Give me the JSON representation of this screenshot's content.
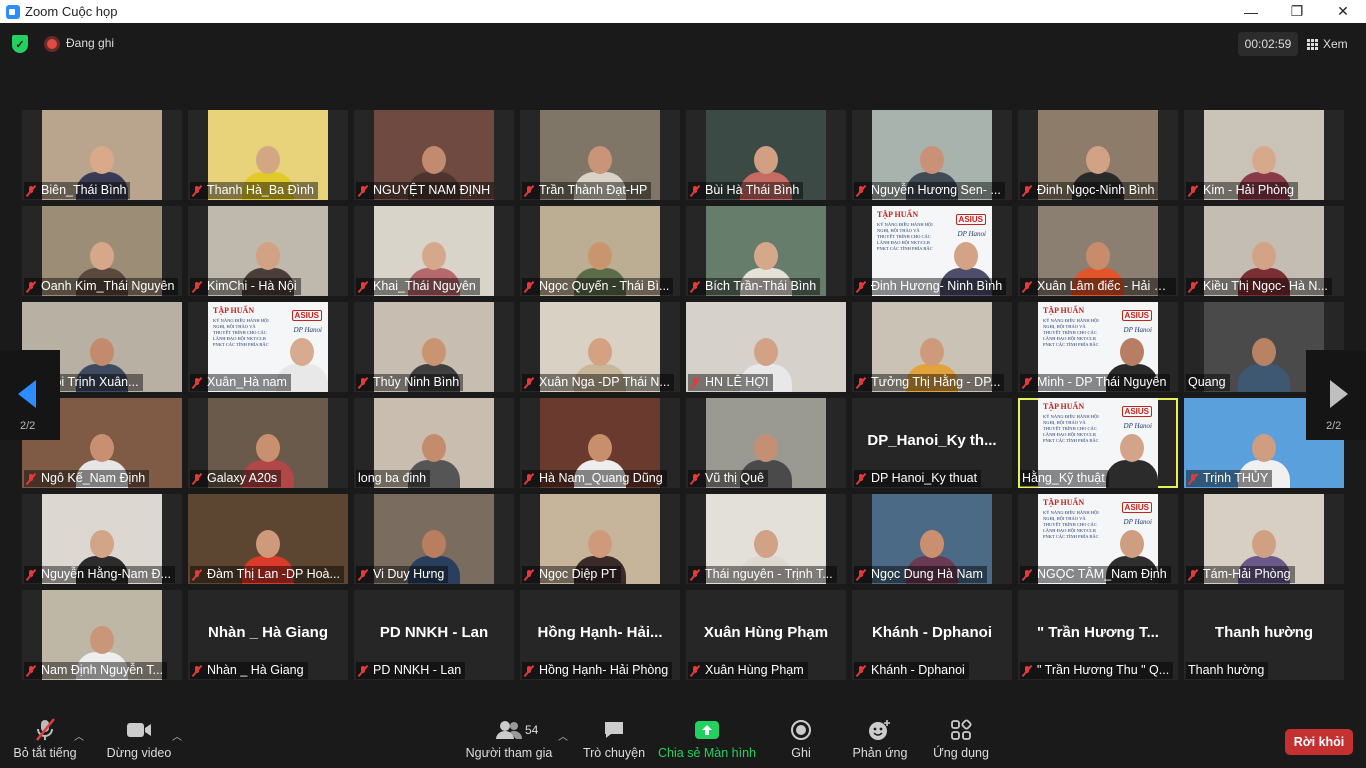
{
  "window": {
    "title": "Zoom Cuộc họp",
    "minimize": "—",
    "restore": "❐",
    "close": "✕"
  },
  "topbar": {
    "recording_label": "Đang ghi",
    "timer": "00:02:59",
    "view_label": "Xem"
  },
  "pagination": {
    "left": "2/2",
    "right": "2/2"
  },
  "participants": [
    {
      "name": "Biên_Thái Bình",
      "muted": true,
      "kind": "video",
      "bg": "#b9a48e",
      "skin": "#d9a98a",
      "shirt": "#3a3a55"
    },
    {
      "name": "Thanh Hà_Ba Đình",
      "muted": true,
      "kind": "video",
      "bg": "#e8d27a",
      "skin": "#d4a784",
      "shirt": "#e2c92a"
    },
    {
      "name": "NGUYỆT NAM  ĐỊNH",
      "muted": true,
      "kind": "video",
      "bg": "#6e4a40",
      "skin": "#c28b70",
      "shirt": "#4c3530"
    },
    {
      "name": "Trần Thành Đạt-HP",
      "muted": true,
      "kind": "video",
      "bg": "#7f7667",
      "skin": "#c99478",
      "shirt": "#d8d2c7"
    },
    {
      "name": "Bùi Hà Thái Bình",
      "muted": true,
      "kind": "video",
      "bg": "#3b4a44",
      "skin": "#d29f82",
      "shirt": "#c66b63"
    },
    {
      "name": "Nguyễn Hương Sen- ...",
      "muted": true,
      "kind": "video",
      "bg": "#a8b3ae",
      "skin": "#c99178",
      "shirt": "#3f4a55"
    },
    {
      "name": "Đinh Ngọc-Ninh Bình",
      "muted": true,
      "kind": "video",
      "bg": "#8d7c6a",
      "skin": "#d2a286",
      "shirt": "#2a2a2a"
    },
    {
      "name": "Kim - Hải Phòng",
      "muted": true,
      "kind": "video",
      "bg": "#c9c3b8",
      "skin": "#d6a98c",
      "shirt": "#8a3b4a"
    },
    {
      "name": "Oanh Kim_Thái Nguyên",
      "muted": true,
      "kind": "video",
      "bg": "#9c8e76",
      "skin": "#d6a789",
      "shirt": "#5a4a3e"
    },
    {
      "name": "KimChi - Hà Nội",
      "muted": true,
      "kind": "video",
      "bg": "#bfb9ad",
      "skin": "#d3a285",
      "shirt": "#4b3e3a"
    },
    {
      "name": "Khai_Thái Nguyên",
      "muted": true,
      "kind": "video",
      "bg": "#d8d4ca",
      "skin": "#d6a88b",
      "shirt": "#b5696d"
    },
    {
      "name": "Ngọc Quyến - Thái Bì...",
      "muted": true,
      "kind": "video",
      "bg": "#bcae92",
      "skin": "#c9956f",
      "shirt": "#5d6d4a"
    },
    {
      "name": "Bích Trần-Thái Bình",
      "muted": true,
      "kind": "video",
      "bg": "#667d6c",
      "skin": "#d6a88b",
      "shirt": "#e6e1d8"
    },
    {
      "name": "Đinh Hương- Ninh Bình",
      "muted": true,
      "kind": "slide",
      "bg": "#f4f6f7",
      "skin": "#d4a286",
      "shirt": "#4e4e6a"
    },
    {
      "name": "Xuân Lâm điếc - Hải Phò...",
      "muted": true,
      "kind": "video",
      "bg": "#8b7f72",
      "skin": "#c88c6d",
      "shirt": "#e2552a"
    },
    {
      "name": "Kiều Thị Ngọc- Hà N...",
      "muted": true,
      "kind": "video",
      "bg": "#c3bdb4",
      "skin": "#d2a386",
      "shirt": "#7b2f33"
    },
    {
      "name": "Hà Nội Trịnh Xuân...",
      "muted": false,
      "kind": "wide",
      "bg": "#b8b0a3",
      "skin": "#c38a6c",
      "shirt": "#3e4a60"
    },
    {
      "name": "Xuân_Hà nam",
      "muted": true,
      "kind": "slide",
      "bg": "#f4f6f7",
      "skin": "#d6ab8f",
      "shirt": "#e8e8e8"
    },
    {
      "name": "Thủy Ninh Bình",
      "muted": true,
      "kind": "video",
      "bg": "#c7beb1",
      "skin": "#c9946f",
      "shirt": "#3f3f3f"
    },
    {
      "name": "Xuân Nga -DP Thái N...",
      "muted": true,
      "kind": "video",
      "bg": "#d9d2c4",
      "skin": "#d4a283",
      "shirt": "#c9b79a"
    },
    {
      "name": "HN LÊ HỢI",
      "muted": true,
      "kind": "wide",
      "bg": "#d6d2cb",
      "skin": "#d2a285",
      "shirt": "#e8e8e8"
    },
    {
      "name": "Tưởng Thị Hằng - DP...",
      "muted": true,
      "kind": "video",
      "bg": "#c9c2b5",
      "skin": "#cf9a7c",
      "shirt": "#e2a33c"
    },
    {
      "name": "Minh - DP Thái Nguyên",
      "muted": true,
      "kind": "slide",
      "bg": "#f4f6f7",
      "skin": "#b77e64",
      "shirt": "#2a2a2a"
    },
    {
      "name": "Quang",
      "muted": false,
      "kind": "video",
      "bg": "#4a4a4a",
      "skin": "#b88363",
      "shirt": "#3e5872"
    },
    {
      "name": "Ngô Kế_Nam Định",
      "muted": true,
      "kind": "wide",
      "bg": "#7f5a45",
      "skin": "#c88f70",
      "shirt": "#e6e6e6"
    },
    {
      "name": "Galaxy A20s",
      "muted": true,
      "kind": "video",
      "bg": "#6a5a4c",
      "skin": "#c9906f",
      "shirt": "#b14747"
    },
    {
      "name": "long ba đinh",
      "muted": false,
      "kind": "video",
      "bg": "#c8bdae",
      "skin": "#c48c6c",
      "shirt": "#555555"
    },
    {
      "name": "Hà Nam_Quang Dũng",
      "muted": true,
      "kind": "video",
      "bg": "#6b3a2e",
      "skin": "#c88f6d",
      "shirt": "#eeeeee"
    },
    {
      "name": "Vũ thị Quê",
      "muted": true,
      "kind": "video",
      "bg": "#9b9a92",
      "skin": "#c39073",
      "shirt": "#4a4a4a"
    },
    {
      "name": "DP Hanoi_Ky thuat",
      "muted": true,
      "kind": "text",
      "big": "DP_Hanoi_Ky th..."
    },
    {
      "name": "Hằng_Kỹ thuật",
      "muted": false,
      "kind": "slide",
      "active": true,
      "bg": "#f4f6f7",
      "skin": "#d4a488",
      "shirt": "#2b2b2b"
    },
    {
      "name": "Trịnh THỦY",
      "muted": true,
      "kind": "wide",
      "bg": "#5aa0dc",
      "skin": "#cf9d80",
      "shirt": "#f0f0f0"
    },
    {
      "name": "Nguyễn Hằng-Nam Đ...",
      "muted": true,
      "kind": "video",
      "bg": "#dcd8d1",
      "skin": "#d3a588",
      "shirt": "#2c2c2c"
    },
    {
      "name": "Đàm Thị Lan -DP Hoà...",
      "muted": true,
      "kind": "wide",
      "bg": "#5c4632",
      "skin": "#cf9a7a",
      "shirt": "#d93a2a"
    },
    {
      "name": "Vi Duy Hưng",
      "muted": true,
      "kind": "video",
      "bg": "#7a6d60",
      "skin": "#b97e5f",
      "shirt": "#2a3e5e"
    },
    {
      "name": "Ngọc Diệp PT",
      "muted": true,
      "kind": "video",
      "bg": "#c6b59a",
      "skin": "#cf9a7b",
      "shirt": "#3a2a2a"
    },
    {
      "name": "Thái nguyên - Trịnh T...",
      "muted": true,
      "kind": "video",
      "bg": "#e3e0da",
      "skin": "#d2a286",
      "shirt": "#ddd8d0"
    },
    {
      "name": "Ngọc Dung Hà Nam",
      "muted": true,
      "kind": "video",
      "bg": "#4a6a86",
      "skin": "#c98f6f",
      "shirt": "#6a3a52"
    },
    {
      "name": "NGỌC TÂM_Nam Định",
      "muted": true,
      "kind": "slide",
      "bg": "#f4f6f7",
      "skin": "#cf9d80",
      "shirt": "#2f2f2f"
    },
    {
      "name": "Tám-Hải Phòng",
      "muted": true,
      "kind": "video",
      "bg": "#d8cfc4",
      "skin": "#d0a083",
      "shirt": "#6a5a8a"
    },
    {
      "name": "Nam Định  Nguyễn T...",
      "muted": true,
      "kind": "video",
      "bg": "#bfb7a6",
      "skin": "#c9967a",
      "shirt": "#eeeeee"
    },
    {
      "name": "Nhàn _ Hà Giang",
      "muted": true,
      "kind": "text",
      "big": "Nhàn _ Hà Giang"
    },
    {
      "name": "PD NNKH - Lan",
      "muted": true,
      "kind": "text",
      "big": "PD NNKH - Lan"
    },
    {
      "name": "Hồng Hạnh- Hải Phòng",
      "muted": true,
      "kind": "text",
      "big": "Hồng  Hạnh-  Hải..."
    },
    {
      "name": "Xuân Hùng Phạm",
      "muted": true,
      "kind": "text",
      "big": "Xuân Hùng Phạm"
    },
    {
      "name": "Khánh - Dphanoi",
      "muted": true,
      "kind": "text",
      "big": "Khánh - Dphanoi"
    },
    {
      "name": "\" Trần Hương Thu \" Q...",
      "muted": true,
      "kind": "text",
      "big": "\" Trần Hương T..."
    },
    {
      "name": "Thanh hường",
      "muted": false,
      "kind": "text",
      "big": "Thanh hường"
    }
  ],
  "slide": {
    "title": "TẬP HUẤN",
    "body": "KỸ NĂNG ĐIỀU HÀNH HỘI NGHỊ, HỘI THẢO VÀ THUYẾT TRÌNH CHO CÁC LÃNH ĐẠO HỘI NKT/CLB PNKT CÁC TỈNH PHÍA BẮC",
    "logo": "ASIUS",
    "org": "DP Hanoi"
  },
  "toolbar": {
    "mute_label": "Bỏ tắt tiếng",
    "video_label": "Dừng video",
    "participants_label": "Người tham gia",
    "participants_count": "54",
    "chat_label": "Trò chuyện",
    "share_label": "Chia sẻ Màn hình",
    "record_label": "Ghi",
    "reactions_label": "Phản ứng",
    "apps_label": "Ứng dụng",
    "leave_label": "Rời khỏi"
  },
  "colors": {
    "accent": "#2d8cff",
    "share": "#23d160",
    "leave": "#c53030",
    "active_border": "#e8f05a",
    "muted_icon": "#e23b3b"
  }
}
